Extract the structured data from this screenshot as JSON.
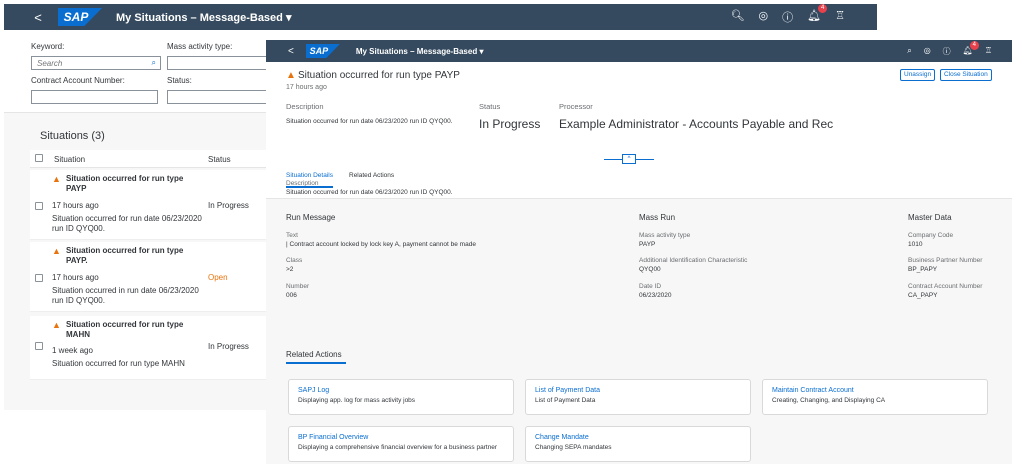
{
  "background_app": {
    "header": {
      "back": "<",
      "logo": "SAP",
      "title": "My Situations – Message-Based ▾",
      "icons": [
        "search-icon",
        "settings-icon",
        "help-icon",
        "notification-icon",
        "user-icon"
      ],
      "notification_count": "4"
    },
    "filters": {
      "keyword_label": "Keyword:",
      "search_placeholder": "Search",
      "mass_activity_label": "Mass activity type:",
      "contract_account_label": "Contract Account Number:",
      "status_label": "Status:"
    },
    "list": {
      "title": "Situations (3)",
      "col_situation": "Situation",
      "col_status": "Status",
      "items": [
        {
          "title": "Situation occurred for run type PAYP",
          "time": "17 hours ago",
          "desc": "Situation occurred for run date 06/23/2020 run ID QYQ00.",
          "status": "In Progress",
          "status_color": "#32363a"
        },
        {
          "title": "Situation occurred for run type PAYP.",
          "time": "17 hours ago",
          "desc": "Situation occurred in run date 06/23/2020 run ID QYQ00.",
          "status": "Open",
          "status_color": "#e9730c"
        },
        {
          "title": "Situation occurred for run type MAHN",
          "time": "1 week ago",
          "desc": "Situation occurred for run type MAHN",
          "status": "In Progress",
          "status_color": "#32363a"
        }
      ]
    }
  },
  "foreground_app": {
    "header": {
      "back": "<",
      "logo": "SAP",
      "title": "My Situations – Message-Based ▾",
      "notification_count": "4"
    },
    "object": {
      "title": "Situation occurred for run type PAYP",
      "subtitle": "17 hours ago",
      "unassign": "Unassign",
      "close": "Close Situation",
      "description_label": "Description",
      "description_value": "Situation occurred for run date 06/23/2020 run ID QYQ00.",
      "status_label": "Status",
      "status_value": "In Progress",
      "processor_label": "Processor",
      "processor_value": "Example Administrator - Accounts Payable and Rec",
      "collapse": "^"
    },
    "tabs": [
      "Situation Details",
      "Related Actions"
    ],
    "details": {
      "description_label": "Description",
      "description_value": "Situation occurred for run date 06/23/2020 run ID QYQ00.",
      "run_message": {
        "title": "Run Message",
        "text_label": "Text",
        "text_value": "| Contract account locked by lock key A, payment cannot be made",
        "class_label": "Class",
        "class_value": ">2",
        "number_label": "Number",
        "number_value": "006"
      },
      "mass_run": {
        "title": "Mass Run",
        "type_label": "Mass activity type",
        "type_value": "PAYP",
        "aic_label": "Additional Identification Characteristic",
        "aic_value": "QYQ00",
        "date_label": "Date ID",
        "date_value": "06/23/2020"
      },
      "master_data": {
        "title": "Master Data",
        "company_label": "Company Code",
        "company_value": "1010",
        "bp_label": "Business Partner Number",
        "bp_value": "BP_PAPY",
        "ca_label": "Contract Account Number",
        "ca_value": "CA_PAPY"
      }
    },
    "related_actions": {
      "title": "Related Actions",
      "cards": [
        {
          "title": "SAPJ Log",
          "subtitle": "Displaying app. log for mass activity jobs"
        },
        {
          "title": "List of Payment Data",
          "subtitle": "List of Payment Data"
        },
        {
          "title": "Maintain Contract Account",
          "subtitle": "Creating, Changing, and Displaying CA"
        },
        {
          "title": "BP Financial Overview",
          "subtitle": "Displaying a comprehensive financial overview for a business partner"
        },
        {
          "title": "Change Mandate",
          "subtitle": "Changing SEPA mandates"
        }
      ]
    }
  }
}
